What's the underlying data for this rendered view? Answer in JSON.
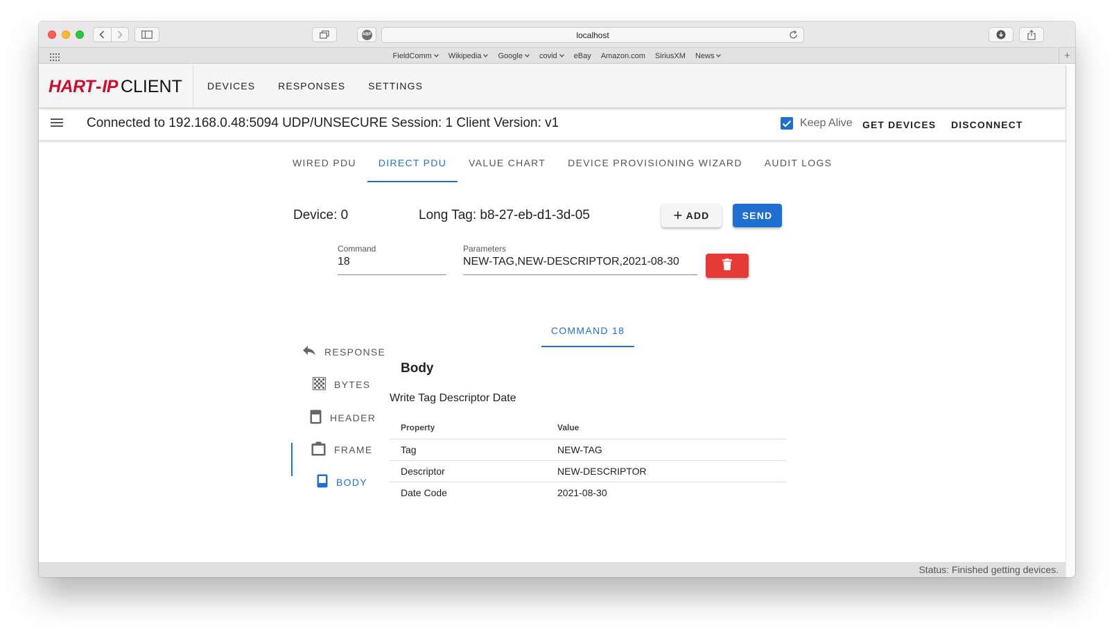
{
  "browser": {
    "address": "localhost",
    "favorites": [
      {
        "label": "FieldComm",
        "dropdown": true
      },
      {
        "label": "Wikipedia",
        "dropdown": true
      },
      {
        "label": "Google",
        "dropdown": true
      },
      {
        "label": "covid",
        "dropdown": true
      },
      {
        "label": "eBay",
        "dropdown": false
      },
      {
        "label": "Amazon.com",
        "dropdown": false
      },
      {
        "label": "SiriusXM",
        "dropdown": false
      },
      {
        "label": "News",
        "dropdown": true
      }
    ]
  },
  "app": {
    "logo": {
      "hart": "HART",
      "dash": "-",
      "ip": "IP",
      "client": "CLIENT"
    },
    "nav": [
      "DEVICES",
      "RESPONSES",
      "SETTINGS"
    ],
    "connection": "Connected to 192.168.0.48:5094 UDP/UNSECURE Session: 1 Client Version: v1",
    "keep_alive": {
      "label": "Keep Alive",
      "checked": true
    },
    "get_devices": "GET DEVICES",
    "disconnect": "DISCONNECT"
  },
  "tabs": {
    "items": [
      "WIRED PDU",
      "DIRECT PDU",
      "VALUE CHART",
      "DEVICE PROVISIONING WIZARD",
      "AUDIT LOGS"
    ],
    "active": "DIRECT PDU"
  },
  "device": {
    "device_label": "Device: 0",
    "long_tag_label": "Long Tag: b8-27-eb-d1-3d-05",
    "add": "ADD",
    "send": "SEND"
  },
  "command_field": {
    "label": "Command",
    "value": "18"
  },
  "parameters_field": {
    "label": "Parameters",
    "value": "NEW-TAG,NEW-DESCRIPTOR,2021-08-30"
  },
  "side_nav": {
    "response": "RESPONSE",
    "bytes": "BYTES",
    "header": "HEADER",
    "frame": "FRAME",
    "body": "BODY",
    "active": "BODY"
  },
  "command_tab": "COMMAND 18",
  "body": {
    "title": "Body",
    "subtitle": "Write Tag Descriptor Date",
    "columns": [
      "Property",
      "Value"
    ],
    "rows": [
      [
        "Tag",
        "NEW-TAG"
      ],
      [
        "Descriptor",
        "NEW-DESCRIPTOR"
      ],
      [
        "Date Code",
        "2021-08-30"
      ]
    ]
  },
  "status": "Status: Finished getting devices.",
  "colors": {
    "primary": "#1f6fd1",
    "danger": "#e53935",
    "brand": "#c8102e"
  }
}
